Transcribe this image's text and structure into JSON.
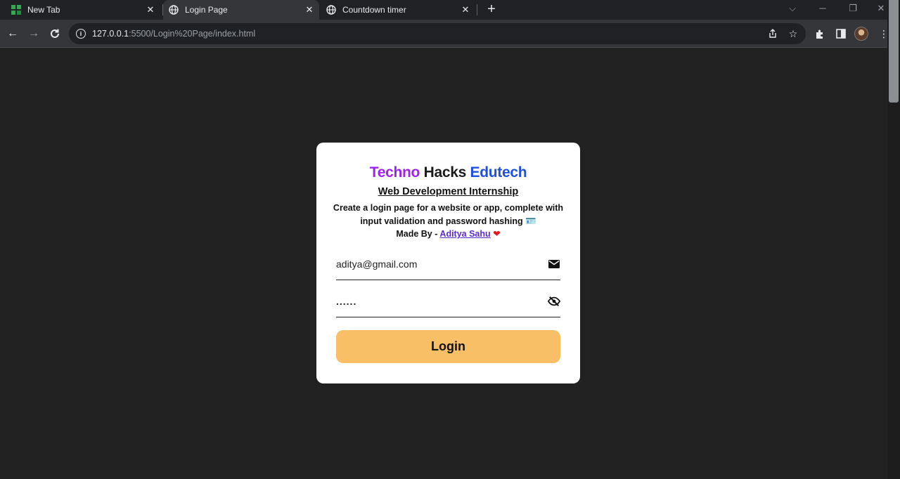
{
  "browser": {
    "tabs": [
      {
        "title": "New Tab",
        "icon": "grid-favicon-icon"
      },
      {
        "title": "Login Page",
        "icon": "globe-icon"
      },
      {
        "title": "Countdown timer",
        "icon": "globe-icon"
      }
    ],
    "active_tab": 1,
    "url_host": "127.0.0.1",
    "url_path": ":5500/Login%20Page/index.html"
  },
  "card": {
    "brand_part1": "Techno",
    "brand_part2": " Hacks ",
    "brand_part3": "Edutech",
    "subtitle": "Web Development Internship",
    "description": "Create a login page for a website or app, complete with input validation and password hashing",
    "description_emoji": "🪪",
    "made_by_prefix": "Made By - ",
    "author": "Aditya Sahu",
    "email_value": "aditya@gmail.com",
    "password_value": "......",
    "login_label": "Login"
  },
  "colors": {
    "page_bg": "#212121",
    "card_bg": "#ffffff",
    "brand_techno": "#a020f0",
    "brand_edutech": "#1f4fe0",
    "button_bg": "#f8bf66",
    "author_link": "#5b2bd1"
  }
}
